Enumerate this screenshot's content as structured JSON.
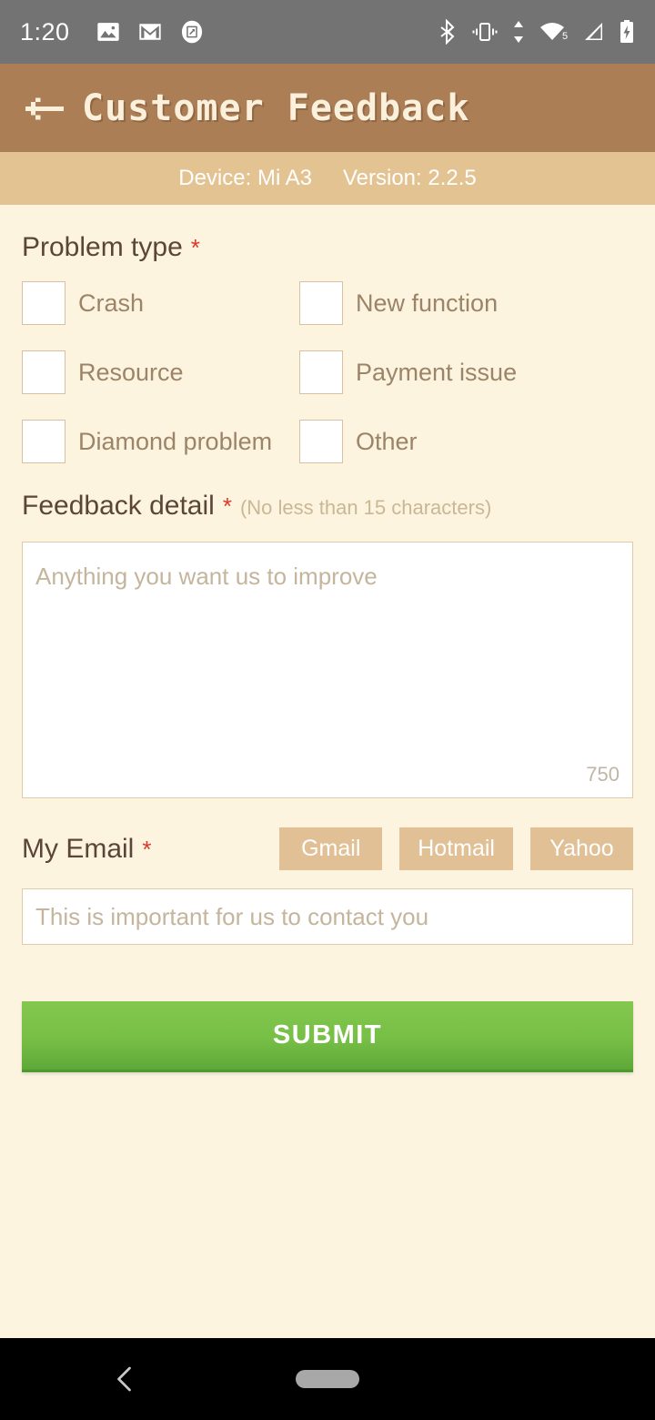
{
  "status_bar": {
    "clock": "1:20",
    "left_icons": [
      "photos-icon",
      "gmail-icon",
      "screenshot-icon"
    ],
    "right_icons": [
      "bluetooth-icon",
      "vibrate-icon",
      "data-transfer-icon",
      "wifi-icon",
      "signal-icon",
      "battery-charging-icon"
    ],
    "wifi_badge": "5"
  },
  "app_bar": {
    "back_icon": "back-arrow-icon",
    "title": "Customer Feedback"
  },
  "device_band": {
    "device": "Device: Mi A3",
    "version": "Version: 2.2.5"
  },
  "problem_type": {
    "label": "Problem type",
    "required_mark": "*",
    "options": [
      {
        "label": "Crash",
        "checked": false
      },
      {
        "label": "New function",
        "checked": false
      },
      {
        "label": "Resource",
        "checked": false
      },
      {
        "label": "Payment issue",
        "checked": false
      },
      {
        "label": "Diamond problem",
        "checked": false
      },
      {
        "label": "Other",
        "checked": false
      }
    ]
  },
  "feedback_detail": {
    "label": "Feedback detail",
    "required_mark": "*",
    "hint": "(No less than 15 characters)",
    "placeholder": "Anything you want us to improve",
    "value": "",
    "char_counter": "750"
  },
  "email": {
    "label": "My Email",
    "required_mark": "*",
    "placeholder": "This is important for us to contact you",
    "value": "",
    "providers": [
      "Gmail",
      "Hotmail",
      "Yahoo"
    ]
  },
  "submit": {
    "label": "SUBMIT"
  },
  "nav_bar": {
    "back_icon": "nav-back-icon",
    "home_icon": "nav-home-pill"
  },
  "colors": {
    "status_bar": "#737373",
    "app_bar": "#AC7E55",
    "device_band": "#E3C392",
    "page_background": "#FDF4E0",
    "heading_text": "#5B4536",
    "required_red": "#D9392B",
    "label_text": "#9C8468",
    "placeholder_text": "#C4B59C",
    "provider_button": "#E0C094",
    "submit_green": "#77BF46",
    "nav_bar": "#000000"
  }
}
